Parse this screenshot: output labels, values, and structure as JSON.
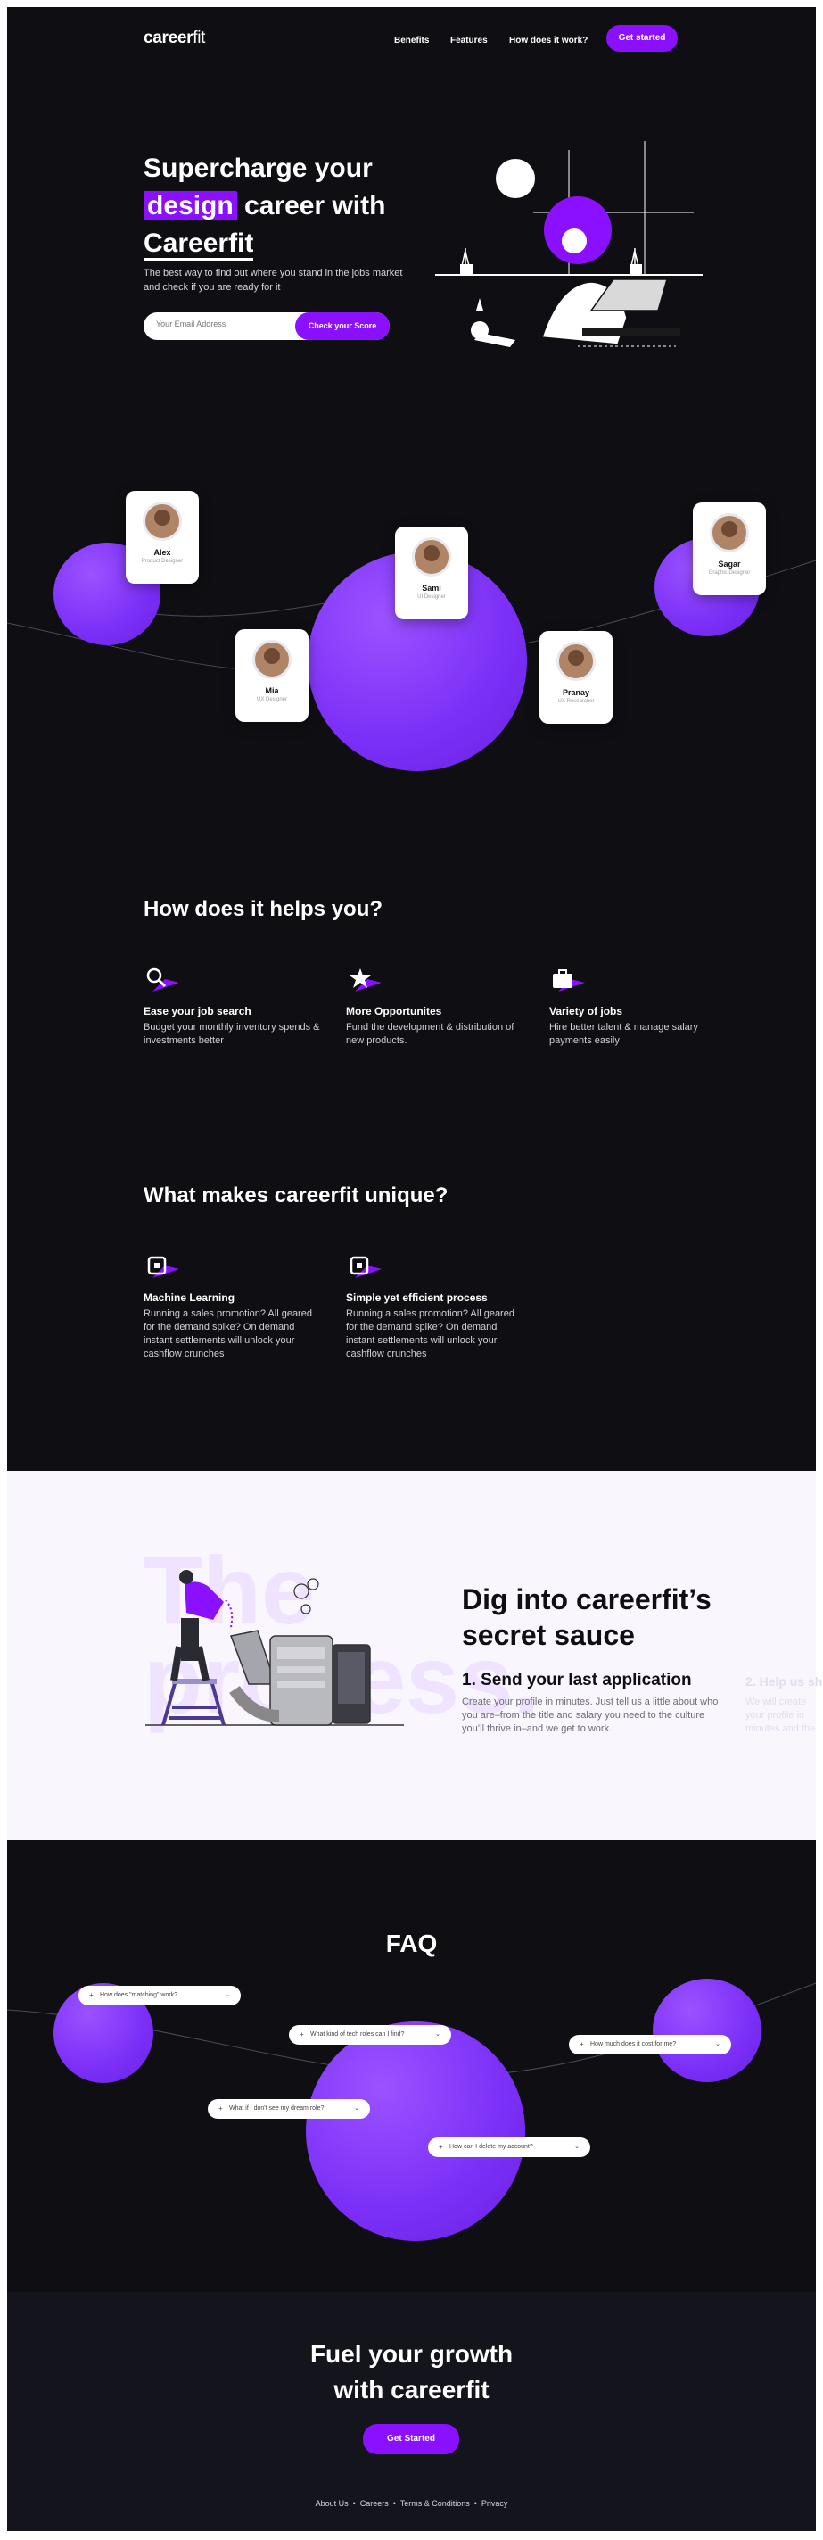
{
  "header": {
    "logo_bold": "career",
    "logo_thin": "fit",
    "nav": [
      "Benefits",
      "Features",
      "How does it work?"
    ],
    "cta": "Get started"
  },
  "hero": {
    "title_line1": "Supercharge your",
    "title_highlight": "design",
    "title_line2_rest": " career with",
    "title_line3": "Careerfit",
    "subtitle": "The best way to find out where you stand in the jobs market and check if you are ready for it",
    "email_placeholder": "Your Email Address",
    "check_button": "Check your Score"
  },
  "profiles": [
    {
      "name": "Alex",
      "role": "Product Designer"
    },
    {
      "name": "Sami",
      "role": "UI Designer"
    },
    {
      "name": "Mia",
      "role": "UX Designer"
    },
    {
      "name": "Pranay",
      "role": "UX Researcher"
    },
    {
      "name": "Sagar",
      "role": "Graphic Designer"
    }
  ],
  "helps": {
    "title": "How does it helps you?",
    "items": [
      {
        "icon": "search-icon",
        "title": "Ease your job search",
        "desc": "Budget your monthly inventory spends & investments better"
      },
      {
        "icon": "star-icon",
        "title": "More Opportunites",
        "desc": "Fund the development & distribution of new products."
      },
      {
        "icon": "briefcase-icon",
        "title": "Variety of jobs",
        "desc": "Hire better talent & manage salary payments easily"
      }
    ]
  },
  "unique": {
    "title": "What makes careerfit unique?",
    "items": [
      {
        "icon": "chip-icon",
        "title": "Machine Learning",
        "desc": "Running a sales promotion? All geared for the demand spike? On demand instant settlements will unlock your cashflow crunches"
      },
      {
        "icon": "chip-icon",
        "title": "Simple yet efficient process",
        "desc": "Running a sales promotion? All geared for the demand spike? On demand instant settlements will unlock your cashflow crunches"
      }
    ]
  },
  "process": {
    "ghost_line1": "The",
    "ghost_line2": "process.",
    "title_line1": "Dig into careerfit’s",
    "title_line2": "secret sauce",
    "step1_title": "1. Send your last application",
    "step1_desc": "Create your profile in minutes. Just tell us a little about who you are–from the title and salary you need to the culture you’ll thrive in–and we get to work.",
    "step2_title": "2. Help us sh",
    "step2_desc": "We will create your profile in minutes and the salary you need and more about..."
  },
  "faq": {
    "title": "FAQ",
    "questions": [
      "How does \"matching\" work?",
      "What kind of tech roles can I find?",
      "How much does it cost for me?",
      "What if I don't see my dream role?",
      "How can I delete my account?"
    ]
  },
  "footer": {
    "title_line1": "Fuel your growth",
    "title_line2": "with careerfit",
    "cta": "Get Started",
    "links": "About Us  •  Careers  •  Terms & Conditions  •  Privacy"
  },
  "colors": {
    "accent": "#8a10ff",
    "blob": "#7b2ff7",
    "dark": "#0f0e12",
    "light": "#f9f6fe"
  }
}
